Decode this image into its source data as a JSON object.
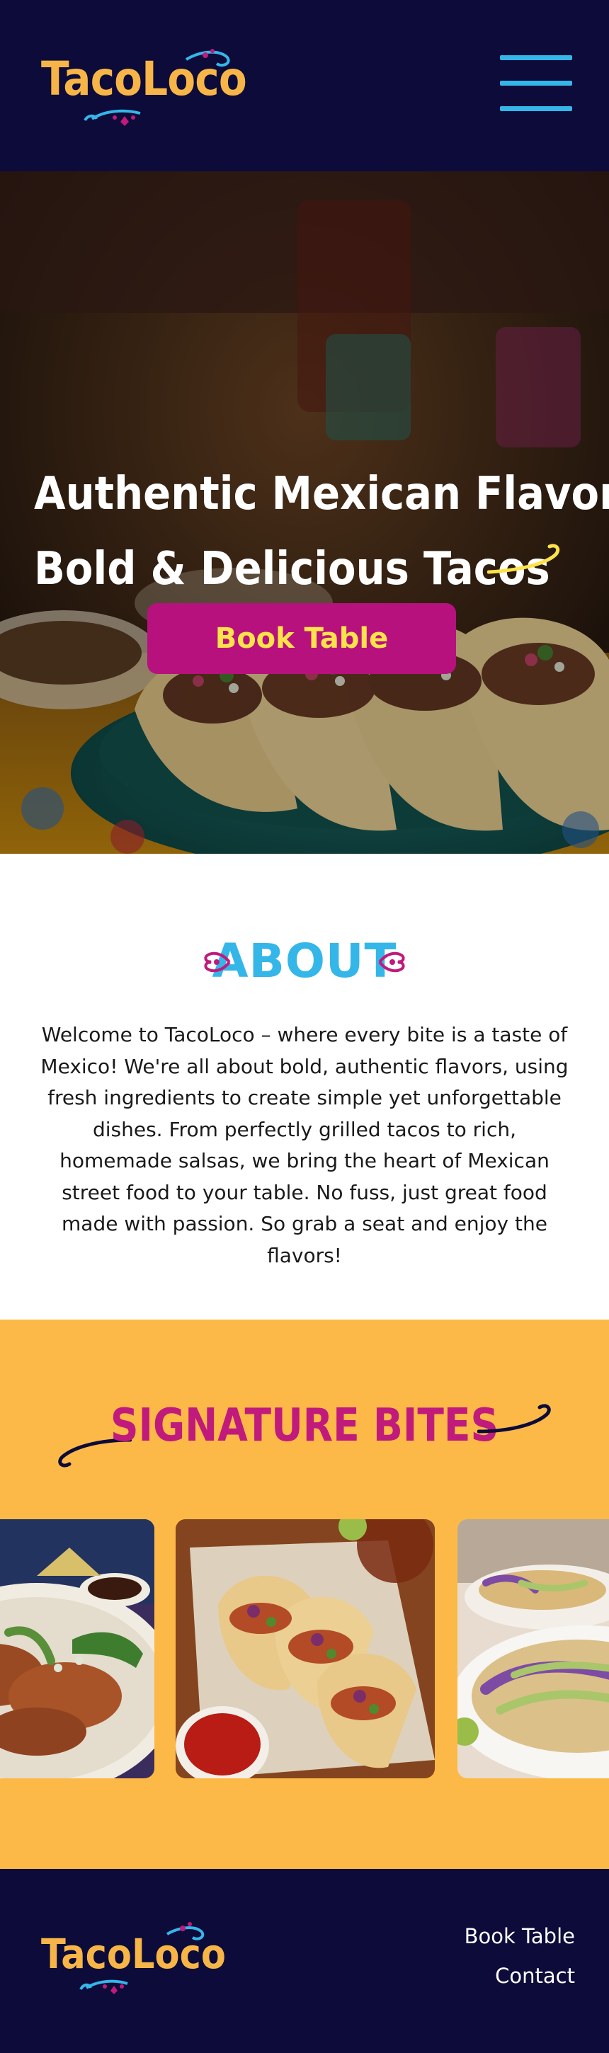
{
  "brand": {
    "name": "TacoLoco"
  },
  "header": {
    "menu_icon": "hamburger-menu-icon"
  },
  "hero": {
    "line1": "Authentic Mexican Flavors",
    "line2": "Bold & Delicious Tacos",
    "cta_label": "Book Table"
  },
  "about": {
    "title": "ABOUT",
    "body": "Welcome to TacoLoco – where every bite is a taste of Mexico! We're all about bold, authentic flavors, using fresh ingredients to create simple yet unforgettable dishes. From perfectly grilled tacos to rich, homemade salsas, we bring the heart of Mexican street food to your table. No fuss, just great food made with passion. So grab a seat and enjoy the flavors!"
  },
  "signature": {
    "title": "SIGNATURE BITES"
  },
  "footer": {
    "links": [
      "Book Table",
      "Contact"
    ]
  },
  "colors": {
    "navy": "#0c0b3a",
    "logo_orange": "#f7b548",
    "accent_blue": "#35b6e8",
    "magenta": "#b7117e",
    "button_text_yellow": "#fde34a",
    "section_orange": "#fdb947",
    "title_pink": "#c01a7c"
  }
}
